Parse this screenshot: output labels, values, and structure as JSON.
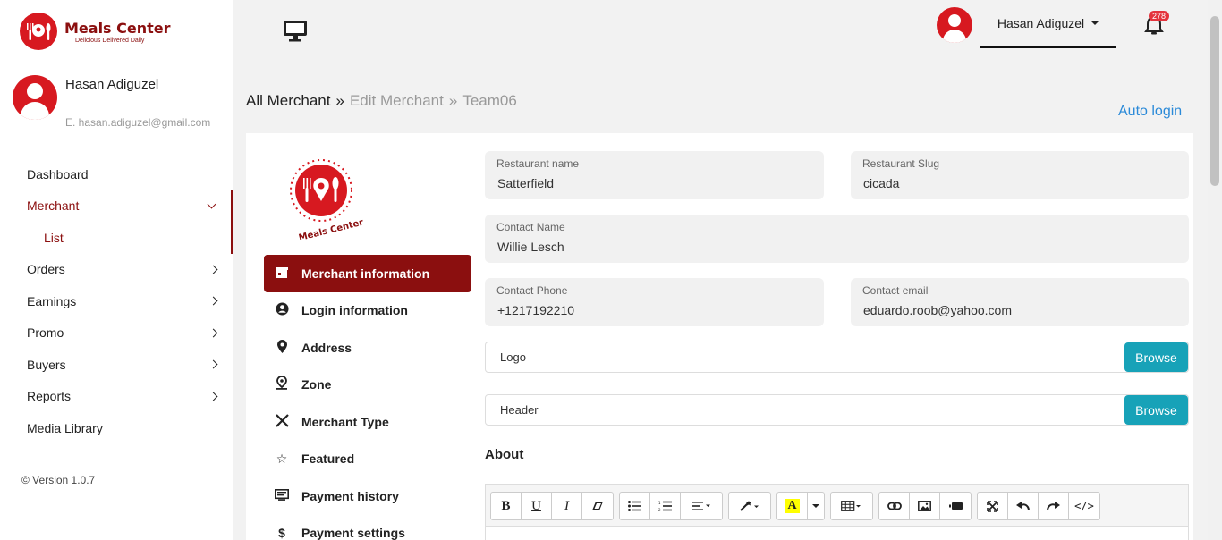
{
  "brand": {
    "name": "Meals Center",
    "tagline": "Delicious Delivered Daily"
  },
  "user": {
    "name": "Hasan Adiguzel",
    "email": "E. hasan.adiguzel@gmail.com"
  },
  "nav": {
    "dashboard": "Dashboard",
    "merchant": "Merchant",
    "merchant_list": "List",
    "orders": "Orders",
    "earnings": "Earnings",
    "promo": "Promo",
    "buyers": "Buyers",
    "reports": "Reports",
    "media_library": "Media Library"
  },
  "version": "© Version 1.0.7",
  "topbar": {
    "user_name": "Hasan Adiguzel",
    "notifications": "278"
  },
  "breadcrumb": {
    "root": "All Merchant",
    "sep1": "»",
    "step": "Edit Merchant",
    "sep2": "»",
    "current": "Team06"
  },
  "auto_login": "Auto login",
  "menu": {
    "merchant_information": "Merchant information",
    "login_information": "Login information",
    "address": "Address",
    "zone": "Zone",
    "merchant_type": "Merchant Type",
    "featured": "Featured",
    "payment_history": "Payment history",
    "payment_settings": "Payment settings"
  },
  "form": {
    "restaurant_name": {
      "label": "Restaurant name",
      "value": "Satterfield"
    },
    "restaurant_slug": {
      "label": "Restaurant Slug",
      "value": "cicada"
    },
    "contact_name": {
      "label": "Contact Name",
      "value": "Willie Lesch"
    },
    "contact_phone": {
      "label": "Contact Phone",
      "value": "+1217192210"
    },
    "contact_email": {
      "label": "Contact email",
      "value": "eduardo.roob@yahoo.com"
    },
    "logo": {
      "label": "Logo",
      "button": "Browse"
    },
    "header": {
      "label": "Header",
      "button": "Browse"
    },
    "about_label": "About"
  },
  "colors": {
    "brand": "#8b0f0f",
    "accent_red": "#d71920",
    "browse": "#17a2b8",
    "link": "#2b8ad8"
  }
}
